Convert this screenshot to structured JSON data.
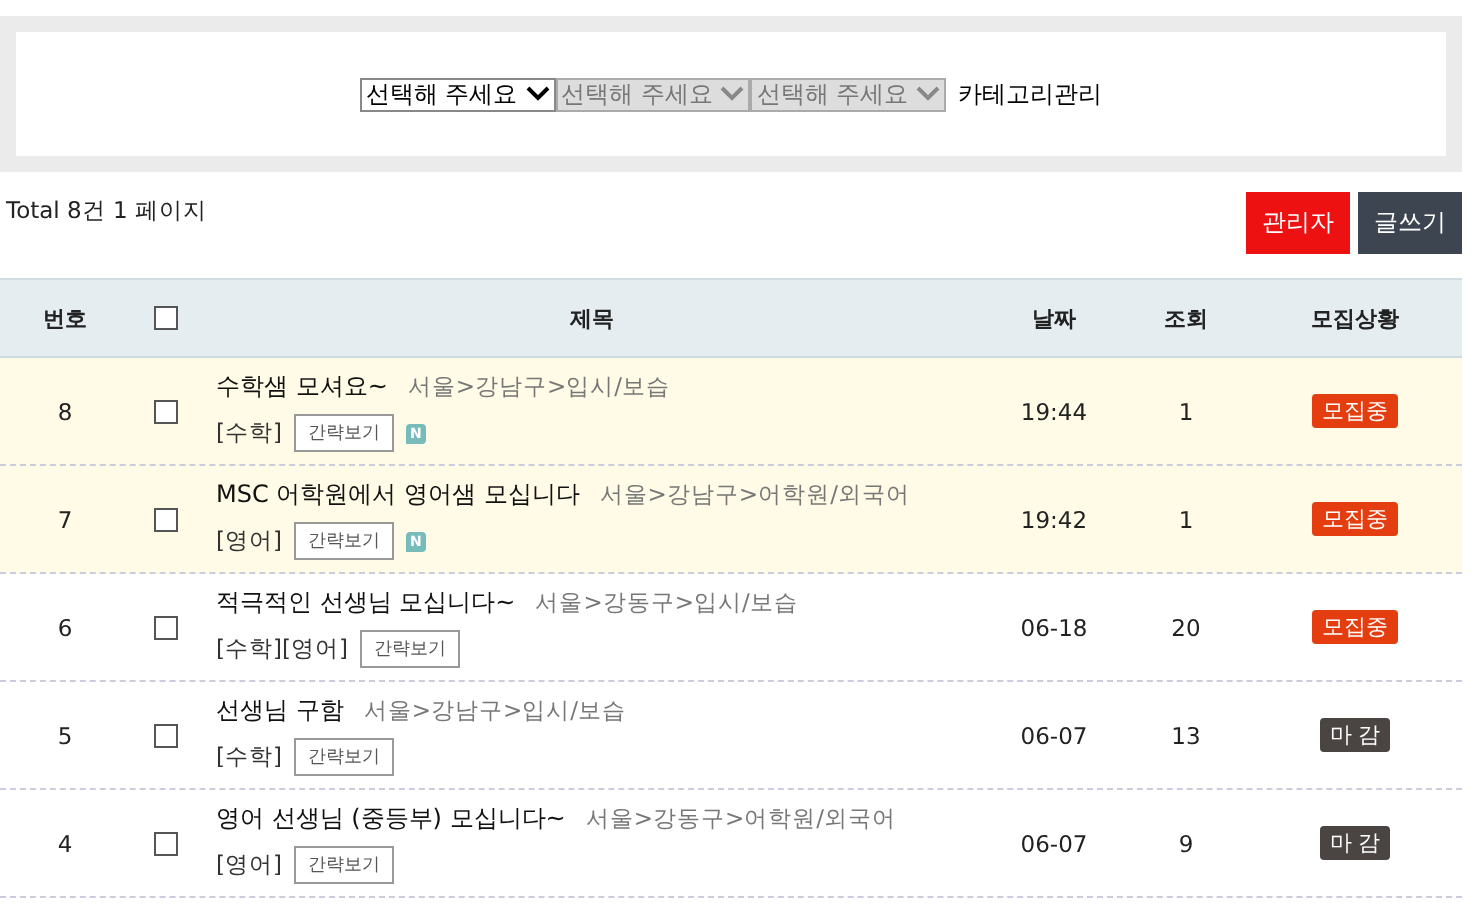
{
  "filters": {
    "selects": [
      {
        "value": "선택해 주세요",
        "disabled": false
      },
      {
        "value": "선택해 주세요",
        "disabled": true
      },
      {
        "value": "선택해 주세요",
        "disabled": true
      }
    ],
    "manage_link": "카테고리관리"
  },
  "summary": "Total 8건 1 페이지",
  "buttons": [
    {
      "label": "관리자",
      "kind": "admin"
    },
    {
      "label": "글쓰기",
      "kind": "write"
    }
  ],
  "table": {
    "columns": [
      "번호",
      "제목",
      "날짜",
      "조회",
      "모집상황"
    ],
    "header_checked": false,
    "rows": [
      {
        "number": "8",
        "checked": false,
        "highlighted": true,
        "title": "수학샘 모셔요~",
        "region": "서울>강남구>입시/보습",
        "subjects": "[수학]",
        "preview": "간략보기",
        "new_badge": "N",
        "date": "19:44",
        "views": "1",
        "status": {
          "label": "모집중",
          "kind": "open"
        }
      },
      {
        "number": "7",
        "checked": false,
        "highlighted": true,
        "title": "MSC 어학원에서 영어샘 모십니다",
        "region": "서울>강남구>어학원/외국어",
        "subjects": "[영어]",
        "preview": "간략보기",
        "new_badge": "N",
        "date": "19:42",
        "views": "1",
        "status": {
          "label": "모집중",
          "kind": "open"
        }
      },
      {
        "number": "6",
        "checked": false,
        "highlighted": false,
        "title": "적극적인 선생님 모십니다~",
        "region": "서울>강동구>입시/보습",
        "subjects": "[수학][영어]",
        "preview": "간략보기",
        "date": "06-18",
        "views": "20",
        "status": {
          "label": "모집중",
          "kind": "open"
        }
      },
      {
        "number": "5",
        "checked": false,
        "highlighted": false,
        "title": "선생님 구함",
        "region": "서울>강남구>입시/보습",
        "subjects": "[수학]",
        "preview": "간략보기",
        "date": "06-07",
        "views": "13",
        "status": {
          "label": "마 감",
          "kind": "closed"
        }
      },
      {
        "number": "4",
        "checked": false,
        "highlighted": false,
        "title": "영어 선생님 (중등부) 모십니다~",
        "region": "서울>강동구>어학원/외국어",
        "subjects": "[영어]",
        "preview": "간략보기",
        "date": "06-07",
        "views": "9",
        "status": {
          "label": "마 감",
          "kind": "closed"
        }
      }
    ]
  }
}
